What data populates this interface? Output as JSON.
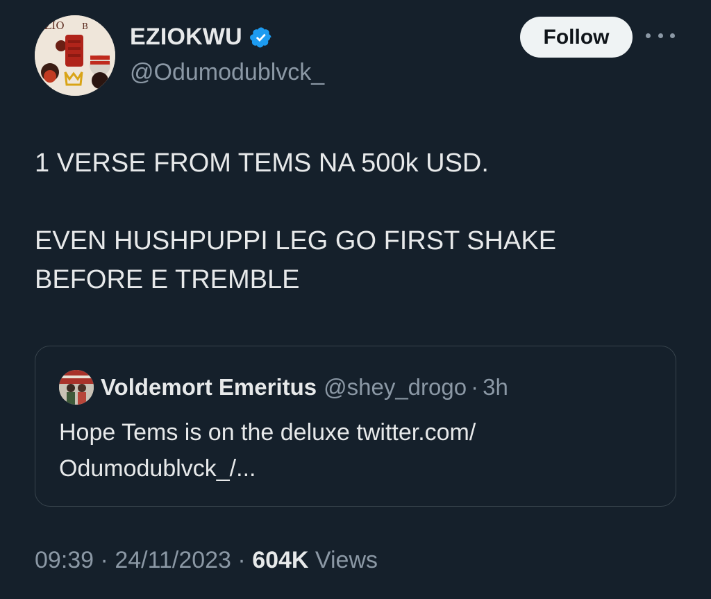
{
  "author": {
    "display_name": "EZIOKWU",
    "handle": "@Odumodublvck_",
    "verified": true,
    "avatar_icon": "album-art-avatar"
  },
  "actions": {
    "follow_label": "Follow",
    "more_icon": "more-options-icon"
  },
  "tweet": {
    "text": "1 VERSE FROM TEMS NA 500k USD.\n\nEVEN HUSHPUPPI LEG GO FIRST SHAKE BEFORE E TREMBLE"
  },
  "quoted_tweet": {
    "display_name": "Voldemort Emeritus",
    "handle": "@shey_drogo",
    "separator": "·",
    "time": "3h",
    "text": "Hope Tems is on the deluxe twitter.com/\nOdumodublvck_/..."
  },
  "meta": {
    "time": "09:39",
    "separator1": " · ",
    "date": "24/11/2023",
    "separator2": " · ",
    "views_count": "604K",
    "views_label": "Views"
  },
  "colors": {
    "background": "#15202b",
    "text_primary": "#e7e9ea",
    "text_secondary": "#8b98a5",
    "verified_blue": "#1d9bf0",
    "border": "#38444d"
  }
}
